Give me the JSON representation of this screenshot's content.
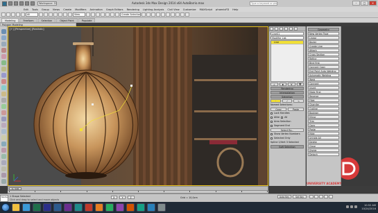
{
  "app": {
    "title": "Autodesk 3ds Max Design 2014 x64    AutoBarrio.max",
    "workspace": "Workspace: Default",
    "search_placeholder": "Type a keyword or phrase"
  },
  "menu": [
    "Edit",
    "Tools",
    "Group",
    "Views",
    "Create",
    "Modifiers",
    "Animation",
    "Graph Editors",
    "Rendering",
    "Lighting Analysis",
    "Civil View",
    "Customize",
    "MAXScript",
    "phoenixFD",
    "Help"
  ],
  "toolbar": {
    "filter": "All",
    "ref_coord": "View",
    "selection_set": "Create Selection Se"
  },
  "ribbon": {
    "tabs": [
      "Modeling",
      "Freeform",
      "Selection",
      "Object Paint",
      "Populate"
    ],
    "active": "Modeling",
    "sub": "Polygon Modeling"
  },
  "viewport": {
    "label": "[+] [Perspective] [Realistic]"
  },
  "command_panel": {
    "object_name": "Line01",
    "modifier_list": "Modifier List",
    "stack": [
      "Line"
    ],
    "rollouts": [
      "Rendering",
      "Interpolation",
      "Selection",
      "Soft Selection",
      "Geometry"
    ],
    "named_selections_label": "Named Selections:",
    "copy_label": "Copy",
    "paste_label": "Paste",
    "options": [
      "Lock Handles",
      "Alike",
      "All",
      "Area Selection",
      "Segment End",
      "Select By..."
    ],
    "show_vertex_numbers": "Show Vertex Numbers",
    "selected_only": "Selected Only",
    "status": "Spline 1/Vert 3 Selected"
  },
  "right_panel": {
    "items": [
      "New Vertex Type",
      "Linear",
      "Bezier",
      "Smooth",
      "Bezier Corner",
      "Create Line",
      "Break",
      "Attach",
      "Attach Mult.",
      "Reorient",
      "Cross Section",
      "Refine",
      "Connect",
      "Linear",
      "Bind first",
      "Bind last",
      "Connect Copy",
      "Threshold",
      "End Point Auto-Welding",
      "Automatic Welding",
      "Threshold",
      "Weld",
      "Connect",
      "Insert",
      "Make First",
      "Fuse",
      "Reverse",
      "Cycle",
      "CrossInsert",
      "Fillet",
      "Chamfer",
      "Outline",
      "Boolean",
      "Mirror",
      "Trim",
      "Extend",
      "Infinite Bounds",
      "Tangent",
      "Copy",
      "Paste",
      "Paste Length",
      "Hide",
      "Unhide All",
      "Bind",
      "Unbind",
      "Delete",
      "Close",
      "Divide",
      "Detach"
    ]
  },
  "timeline": {
    "frame": "0 / 100",
    "ticks": [
      "0",
      "10",
      "20",
      "30",
      "40",
      "50",
      "60",
      "70",
      "80",
      "90",
      "100"
    ]
  },
  "status": {
    "listener": "MAXScript Mi",
    "line1": "1 Shape Selected",
    "line2": "Click and drag to select and move objects",
    "x": "X:",
    "y": "Y:",
    "z": "Z:",
    "grid": "Grid = 10,0cm",
    "autokey": "Auto Key",
    "setkey": "Set Key",
    "key_filter": "Selected",
    "key_filters_label": "Key Filters..."
  },
  "taskbar": {
    "time": "10:52 AM",
    "date": "10/24/2016"
  },
  "colors": {
    "viewport_border": "#e8c21b",
    "stack_highlight": "#f2e036",
    "taskbar": "#1f2a36",
    "watermark_red": "#d63a3a"
  },
  "watermark": "UNIVERSITY ACADEMY"
}
